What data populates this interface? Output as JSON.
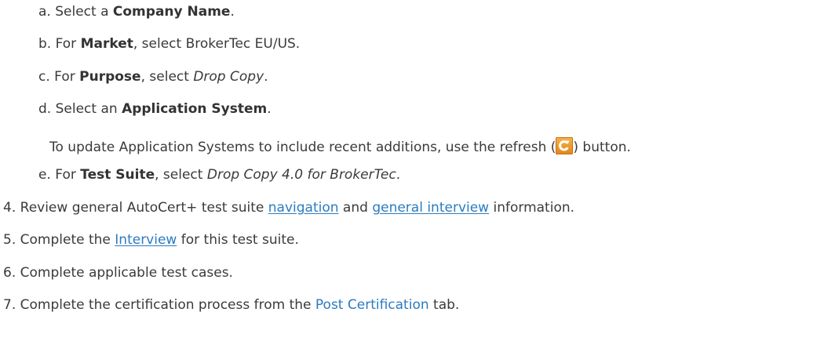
{
  "list": {
    "sub_items": [
      {
        "marker": "a.",
        "pre": "Select a ",
        "bold": "Company Name",
        "post": "."
      },
      {
        "marker": "b.",
        "pre": "For ",
        "bold": "Market",
        "post": ", select BrokerTec EU/US."
      },
      {
        "marker": "c.",
        "pre": "For ",
        "bold": "Purpose",
        "mid": ", select ",
        "italic": "Drop Copy",
        "post": "."
      },
      {
        "marker": "d.",
        "pre": "Select an ",
        "bold": "Application System",
        "post": "."
      },
      {
        "marker": "e.",
        "pre": "For ",
        "bold": "Test Suite",
        "mid": ", select ",
        "italic": "Drop Copy 4.0 for BrokerTec",
        "post": "."
      }
    ],
    "note": {
      "pre": "To update Application Systems to include recent additions, use the refresh (",
      "post": ") button."
    },
    "steps": [
      {
        "marker": "4.",
        "pre": "Review general AutoCert+ test suite ",
        "link1": "navigation",
        "mid": " and ",
        "link2": "general interview",
        "post": " information."
      },
      {
        "marker": "5.",
        "pre": "Complete the ",
        "link1": "Interview",
        "post": " for this test suite."
      },
      {
        "marker": "6.",
        "text": "Complete applicable test cases."
      },
      {
        "marker": "7.",
        "pre": "Complete the certification process from the ",
        "link1": "Post Certification",
        "post": " tab."
      }
    ]
  },
  "icons": {
    "refresh": "refresh-icon"
  },
  "colors": {
    "text": "#3a3a3a",
    "link": "#2b7bc1",
    "icon_orange": "#e8921f"
  }
}
